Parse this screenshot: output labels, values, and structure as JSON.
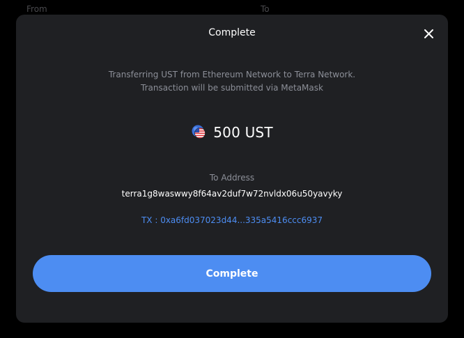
{
  "background": {
    "from_label": "From",
    "to_label": "To"
  },
  "modal": {
    "title": "Complete",
    "close_icon": "close-icon",
    "info_line1": "Transferring UST from Ethereum Network to Terra Network.",
    "info_line2": "Transaction will be submitted via MetaMask",
    "amount": "500 UST",
    "coin_icon": "ust-coin-icon",
    "to_address_label": "To Address",
    "to_address": "terra1g8waswwy8f64av2duf7w72nvldx06u50yavyky",
    "tx_text": "TX : 0xa6fd037023d44...335a5416ccc6937",
    "complete_button_label": "Complete"
  },
  "colors": {
    "page_background": "#000000",
    "modal_background": "#1f2023",
    "accent": "#4d8df2",
    "muted_text": "#8c8f98",
    "text": "#ffffff"
  }
}
